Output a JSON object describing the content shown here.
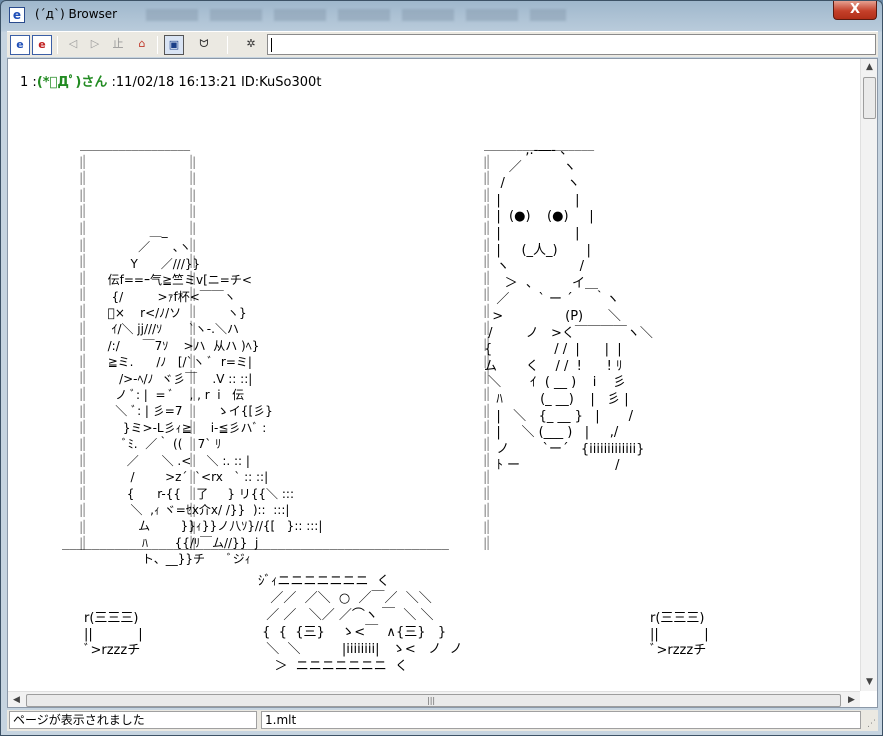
{
  "window": {
    "title": "(´д`) Browser",
    "app_icon": "e",
    "close_label": "X"
  },
  "toolbar": {
    "buttons": [
      {
        "name": "ie-icon",
        "glyph": "e"
      },
      {
        "name": "ie-red-icon",
        "glyph": "e"
      },
      {
        "name": "back-icon",
        "glyph": "◁"
      },
      {
        "name": "forward-icon",
        "glyph": "▷"
      },
      {
        "name": "stop-icon",
        "glyph": "止"
      },
      {
        "name": "home-icon",
        "glyph": "⌂"
      },
      {
        "name": "window-icon",
        "glyph": "▣"
      },
      {
        "name": "cat-face-icon",
        "glyph": "ᗢ"
      },
      {
        "name": "settings-icon",
        "glyph": "✲"
      }
    ],
    "address_value": ""
  },
  "post": {
    "number": "1",
    "separator": ":",
    "name": "(*ﾟДﾟ)さん",
    "date_sep": ":",
    "datetime": "11/02/18 16:13:21",
    "id": "ID:KuSo300t"
  },
  "ascii_art": {
    "left_frame": "＿＿＿＿＿＿＿＿＿＿＿＿＿＿＿＿＿\n|│                                                  │|\n|│                                                  │|\n|│                                                  │|\n|│                                                  │|\n|│                                                  │|\n|│                                                  │|\n|│                                                  │|\n|│                                                  │|\n|│                                                  │|\n|│                                                  │|\n|│                                                  │|\n|│                                                  │|\n|│                                                  │|\n|│                                                  │|\n|│                                                  │|\n|│                                                  │|\n|│                                                  │|\n|│                                                  │|\n|│                                                  │|\n|│                                                  │|\n|│                                                  │|\n|│                                                  │|\n|│                                                  │|\n|│                                                  │|",
    "left_char": "             ＿_\n          ／      ､ヽ\n        Y      ／///}}\n  伝f==ｰ气≧竺ミv[ニ=チ<\n   {/         >ｧf杯<￣￣ヽ\n  ﾞ×    r</ﾉ/ソ            ヽ}\n   ｲ/＼ jj///ｿ       `ヽ-.＼ハ\n  /:/      ￣7ｿ    >ハ  从ハ )ﾍ}\n  ≧ミ.      /ﾉ   [/`ヽ ﾞ  r=ミ|\n     />-ﾍ/ﾉ  ヾ彡￣    .V :: ::|\n    ノ ﾞ: |  = ﾞ    , , r  i   伝\n    ＼ ﾞ: | 彡=7         ゝイ{[彡}\n      }ミ>-L彡ｨ≧     i-≦彡ハﾞ :\n      ﾞﾐ.  ／｀ ((    7` ﾘ\n       ／      ＼ .<    ＼ :. :: |\n        /        >z´  `<rx   ` :: ::|\n       {      r-{{    了     } リ{{＼ :::\n        ＼  ,ｨ ヾ=ｾx介x/ /}}  )::  :::|\n          ム        }}ｨ}}ノ八ｿ}//{[   }:: :::|\n           ﾊ       {{/ﾘ￣ム//}}  j\n           ト、__}}チ      ﾞジｨ",
    "right_frame": "＿＿＿＿＿＿＿＿＿＿＿＿＿＿＿＿＿\n|│\n|│\n|│\n|│\n|│\n|│\n|│\n|│\n|│\n|│\n|│\n|│\n|│\n|│\n|│\n|│\n|│\n|│\n|│\n|│\n|│\n|│\n|│\n|│",
    "right_char": "          ,.-―- 、\n      ／          ヽ\n    /               ヽ\n   |                  |\n   |  (●)    (●)     |\n   |                  |\n   |     (_人_)       |\n   ヽ                 /\n     ＞  、        イ＿\n   ／       ` ー ´     ｀ヽ\n  >               (P)      ＼\n /        ノ   >く￣￣￣￣ヽ＼\n{               / /  |      |  |\nム       く    / /  !      ! ﾘ\n ＼       ｲ  ( __ )    i    彡\n   ﾊ         (_ __)    |   彡 |\n   |   ＼   {_ __ }   |       /\n   |     ＼ (___ )   |     ,/\n   ノ        `ー´   {iiiiiiiiiiiii}\n   ﾄ ー                       /",
    "floor": "￣￣￣￣￣￣￣￣￣￣￣￣￣￣￣￣￣￣￣￣￣￣￣￣￣￣￣￣￣￣￣￣￣￣￣￣￣￣￣￣￣￣￣￣￣￣￣￣￣￣￣￣",
    "left_small": "r(三三三)\n||           |\nﾞ>rzzzチ",
    "center_basket": "ｼﾞｨニニニニニニニ  く\n   ／／  ／＼  ○  ／￣／  ＼＼\n  ／ ／   ＼／ ／⌒ヽ ￣  ＼ ＼\n {  {  {三}    ゝ<￣  ∧{三}   }\n  ＼  ＼          |iiiiiiii|   ゝ<   ノ  ノ\n    ＞  ニニニニニニニ  く",
    "right_small": "r(三三三)\n||           |\nﾞ>rzzzチ"
  },
  "status": {
    "message": "ページが表示されました",
    "file": "1.mlt"
  }
}
